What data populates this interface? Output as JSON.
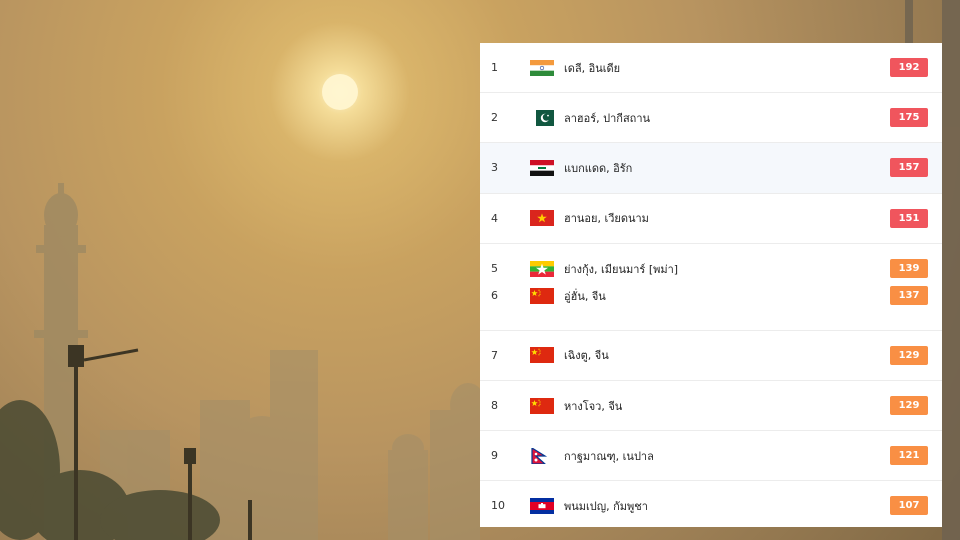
{
  "ranking": {
    "rows": [
      {
        "rank": "1",
        "city": "เดลี, อินเดีย",
        "aqi": "192",
        "flag": "india-flag",
        "level": "red"
      },
      {
        "rank": "2",
        "city": "ลาฮอร์, ปากีสถาน",
        "aqi": "175",
        "flag": "pakistan-flag",
        "level": "red"
      },
      {
        "rank": "3",
        "city": "แบกแดด, อิรัก",
        "aqi": "157",
        "flag": "iraq-flag",
        "level": "red"
      },
      {
        "rank": "4",
        "city": "ฮานอย, เวียดนาม",
        "aqi": "151",
        "flag": "vietnam-flag",
        "level": "red"
      },
      {
        "rank": "5",
        "city": "ย่างกุ้ง, เมียนมาร์ [พม่า]",
        "aqi": "139",
        "flag": "myanmar-flag",
        "level": "orange"
      },
      {
        "rank": "6",
        "city": "อู่ฮั่น, จีน",
        "aqi": "137",
        "flag": "china-flag",
        "level": "orange"
      },
      {
        "rank": "7",
        "city": "เฉิงตู, จีน",
        "aqi": "129",
        "flag": "china-flag",
        "level": "orange"
      },
      {
        "rank": "8",
        "city": "หางโจว, จีน",
        "aqi": "129",
        "flag": "china-flag",
        "level": "orange"
      },
      {
        "rank": "9",
        "city": "กาฐมาณฑุ, เนปาล",
        "aqi": "121",
        "flag": "nepal-flag",
        "level": "orange"
      },
      {
        "rank": "10",
        "city": "พนมเปญ, กัมพูชา",
        "aqi": "107",
        "flag": "cambodia-flag",
        "level": "orange"
      }
    ]
  },
  "colors": {
    "red": "#f0555d",
    "orange": "#f98f44"
  }
}
